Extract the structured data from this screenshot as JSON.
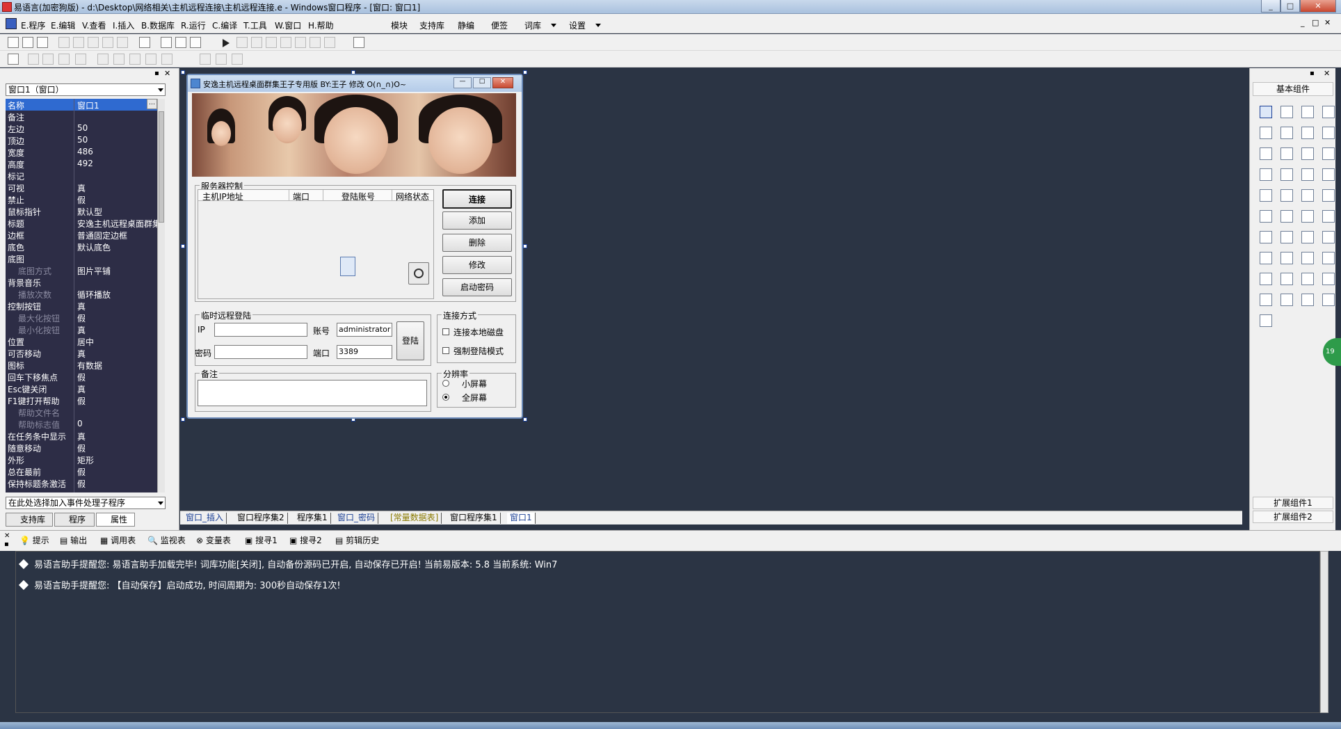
{
  "window": {
    "title": "易语言(加密狗版) - d:\\Desktop\\网络相关\\主机远程连接\\主机远程连接.e - Windows窗口程序 - [窗口: 窗口1]"
  },
  "menu": {
    "items": [
      "E.程序",
      "E.编辑",
      "V.查看",
      "I.插入",
      "B.数据库",
      "R.运行",
      "C.编译",
      "T.工具",
      "W.窗口",
      "H.帮助"
    ],
    "right_items": [
      "模块",
      "支持库",
      "静编",
      "便签",
      "词库",
      "设置"
    ]
  },
  "left_panel": {
    "object_selector": "窗口1（窗口）",
    "properties": [
      {
        "name": "名称",
        "value": "窗口1"
      },
      {
        "name": "备注",
        "value": ""
      },
      {
        "name": "左边",
        "value": "50"
      },
      {
        "name": "顶边",
        "value": "50"
      },
      {
        "name": "宽度",
        "value": "486"
      },
      {
        "name": "高度",
        "value": "492"
      },
      {
        "name": "标记",
        "value": ""
      },
      {
        "name": "可视",
        "value": "真"
      },
      {
        "name": "禁止",
        "value": "假"
      },
      {
        "name": "鼠标指针",
        "value": "默认型"
      },
      {
        "name": "标题",
        "value": "安逸主机远程桌面群集"
      },
      {
        "name": "边框",
        "value": "普通固定边框"
      },
      {
        "name": "底色",
        "value": "默认底色"
      },
      {
        "name": "底图",
        "value": ""
      },
      {
        "name": "底图方式",
        "value": "图片平铺",
        "sub": true
      },
      {
        "name": "背景音乐",
        "value": ""
      },
      {
        "name": "播放次数",
        "value": "循环播放",
        "sub": true
      },
      {
        "name": "控制按钮",
        "value": "真"
      },
      {
        "name": "最大化按钮",
        "value": "假",
        "sub": true
      },
      {
        "name": "最小化按钮",
        "value": "真",
        "sub": true
      },
      {
        "name": "位置",
        "value": "居中"
      },
      {
        "name": "可否移动",
        "value": "真"
      },
      {
        "name": "图标",
        "value": "有数据"
      },
      {
        "name": "回车下移焦点",
        "value": "假"
      },
      {
        "name": "Esc键关闭",
        "value": "真"
      },
      {
        "name": "F1键打开帮助",
        "value": "假"
      },
      {
        "name": "帮助文件名",
        "value": "",
        "sub": true
      },
      {
        "name": "帮助标志值",
        "value": "0",
        "sub": true
      },
      {
        "name": "在任务条中显示",
        "value": "真"
      },
      {
        "name": "随意移动",
        "value": "假"
      },
      {
        "name": "外形",
        "value": "矩形"
      },
      {
        "name": "总在最前",
        "value": "假"
      },
      {
        "name": "保持标题条激活",
        "value": "假"
      }
    ],
    "event_selector": "在此处选择加入事件处理子程序",
    "tabs": [
      "支持库",
      "程序",
      "属性"
    ]
  },
  "design_form": {
    "title": "安逸主机远程桌面群集王子专用版    BY:王子 修改 O(∩_∩)O~",
    "server_group": {
      "label": "服务器控制",
      "columns": [
        "主机IP地址",
        "端口",
        "登陆账号",
        "网络状态"
      ],
      "buttons": [
        "连接",
        "添加",
        "删除",
        "修改",
        "启动密码"
      ]
    },
    "temp_group": {
      "label": "临时远程登陆",
      "ip_label": "IP",
      "pwd_label": "密码",
      "account_label": "账号",
      "account_value": "administrator",
      "port_label": "端口",
      "port_value": "3389",
      "login_button": "登陆"
    },
    "conn_group": {
      "label": "连接方式",
      "options": [
        "连接本地磁盘",
        "强制登陆模式"
      ]
    },
    "note_group": {
      "label": "备注"
    },
    "res_group": {
      "label": "分辨率",
      "options": [
        "小屏幕",
        "全屏幕"
      ],
      "selected": "全屏幕"
    }
  },
  "doc_tabs": [
    "窗口_插入",
    "窗口程序集2",
    "程序集1",
    "窗口_密码",
    "[常量数据表]",
    "窗口程序集1",
    "窗口1"
  ],
  "toolbox": {
    "title": "基本组件",
    "ext1": "扩展组件1",
    "ext2": "扩展组件2",
    "side_badge": "19"
  },
  "output_tabs": [
    "提示",
    "输出",
    "调用表",
    "监视表",
    "变量表",
    "搜寻1",
    "搜寻2",
    "剪辑历史"
  ],
  "output_lines": [
    "易语言助手提醒您:  易语言助手加载完毕!  词库功能[关闭], 自动备份源码已开启, 自动保存已开启!  当前易版本: 5.8  当前系统: Win7",
    "易语言助手提醒您: 【自动保存】启动成功, 时间周期为: 300秒自动保存1次!"
  ],
  "colors": {
    "editor_bg": "#2b3444",
    "prop_bg": "#2d2d46",
    "selection": "#2f6ad0"
  }
}
